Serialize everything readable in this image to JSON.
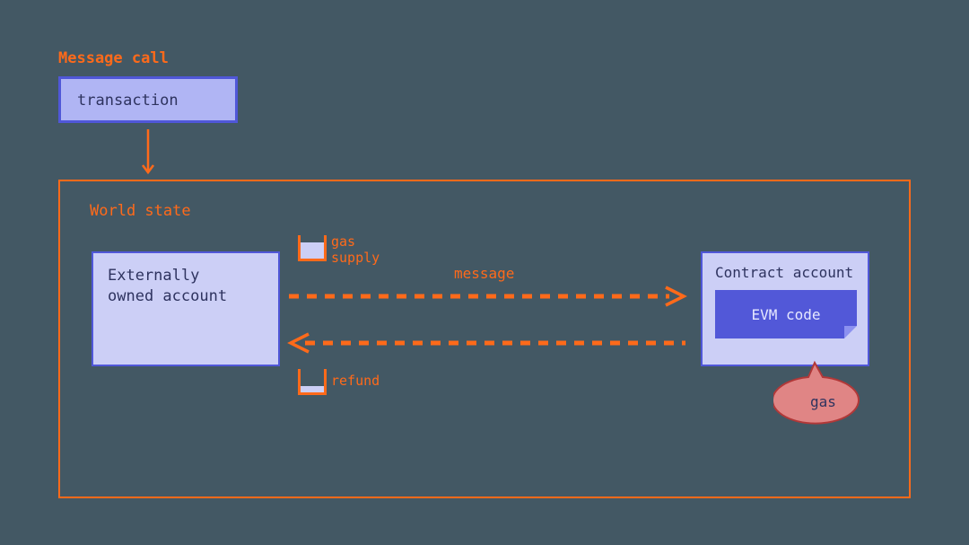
{
  "title": "Message call",
  "transaction_label": "transaction",
  "world_state_label": "World state",
  "eoa_label_line1": "Externally",
  "eoa_label_line2": "owned account",
  "contract_label": "Contract account",
  "evm_label": "EVM code",
  "message_label": "message",
  "gas_supply_line1": "gas",
  "gas_supply_line2": "supply",
  "refund_label": "refund",
  "gas_bubble_label": "gas",
  "colors": {
    "background": "#435864",
    "orange": "#FF6A1A",
    "box_border": "#5057D8",
    "box_fill_light": "#CCCFF6",
    "box_fill_mid": "#B0B5F4",
    "evm_fill": "#5258D8",
    "bubble_fill": "#E08585",
    "bubble_stroke": "#B13838"
  }
}
